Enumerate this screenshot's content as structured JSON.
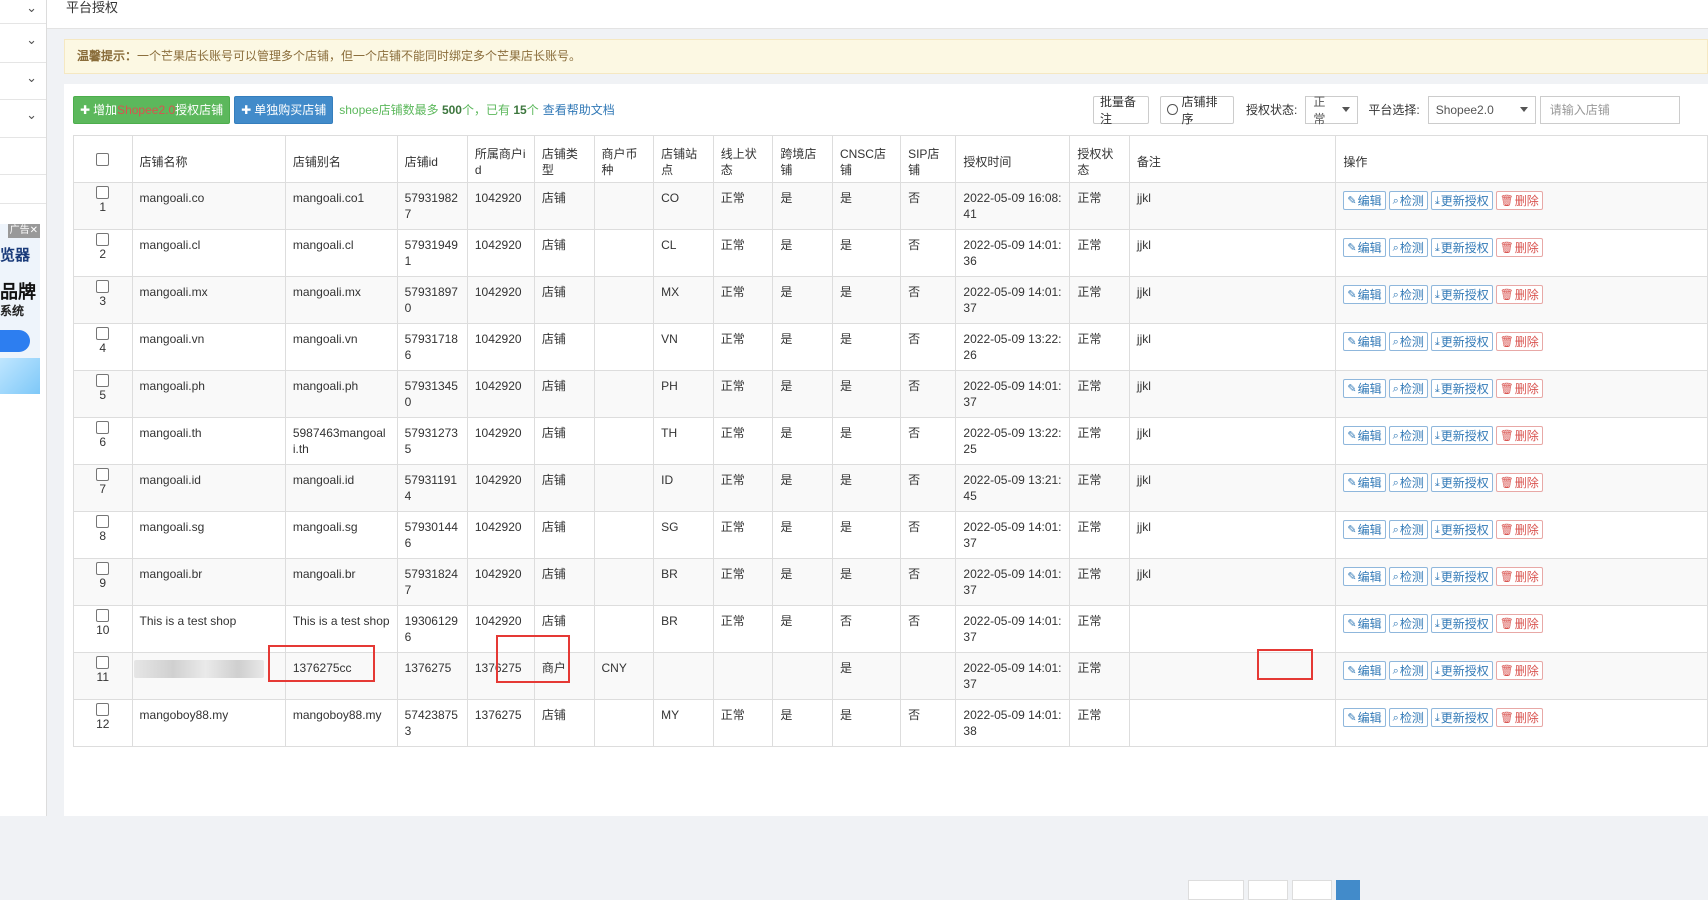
{
  "page": {
    "breadcrumb": "平台授权"
  },
  "tip": {
    "label": "温馨提示：",
    "text": "一个芒果店长账号可以管理多个店铺，但一个店铺不能同时绑定多个芒果店长账号。"
  },
  "toolbar": {
    "add_prefix": "增加",
    "add_highlight": "Shopee2.0",
    "add_suffix": "授权店铺",
    "buy_label": "单独购买店铺",
    "info_prefix": "shopee店铺数最多 ",
    "max_shops": "500",
    "info_middle": "个，已有 ",
    "current_shops": "15",
    "info_suffix": "个",
    "help_link": "查看帮助文档",
    "batch_note": "批量备注",
    "sort_label": "店铺排序",
    "auth_status_label": "授权状态:",
    "auth_status_value": "正常",
    "platform_label": "平台选择:",
    "platform_value": "Shopee2.0",
    "search_placeholder": "请输入店铺"
  },
  "sidebar": {
    "ad_tag": "广告",
    "ad_close": "✕",
    "ad_line1": "览器",
    "ad_line2": "品牌",
    "ad_line3": "系统"
  },
  "table": {
    "headers": {
      "name": "店铺名称",
      "alias": "店铺别名",
      "id": "店铺id",
      "merchant_id": "所属商户id",
      "type": "店铺类型",
      "currency": "商户币种",
      "site": "店铺站点",
      "online": "线上状态",
      "cross": "跨境店铺",
      "cnsc": "CNSC店铺",
      "sip": "SIP店铺",
      "auth_time": "授权时间",
      "auth_status": "授权状态",
      "note": "备注",
      "ops": "操作"
    },
    "ops": {
      "edit": "编辑",
      "check": "检测",
      "renew": "更新授权",
      "delete": "删除"
    },
    "rows": [
      {
        "idx": "1",
        "name": "mangoali.co",
        "alias": "mangoali.co1",
        "id": "579319827",
        "merchant_id": "1042920",
        "type": "店铺",
        "currency": "",
        "site": "CO",
        "online": "正常",
        "cross": "是",
        "cnsc": "是",
        "sip": "否",
        "auth_time": "2022-05-09 16:08:41",
        "auth_status": "正常",
        "note": "jjkl"
      },
      {
        "idx": "2",
        "name": "mangoali.cl",
        "alias": "mangoali.cl",
        "id": "579319491",
        "merchant_id": "1042920",
        "type": "店铺",
        "currency": "",
        "site": "CL",
        "online": "正常",
        "cross": "是",
        "cnsc": "是",
        "sip": "否",
        "auth_time": "2022-05-09 14:01:36",
        "auth_status": "正常",
        "note": "jjkl"
      },
      {
        "idx": "3",
        "name": "mangoali.mx",
        "alias": "mangoali.mx",
        "id": "579318970",
        "merchant_id": "1042920",
        "type": "店铺",
        "currency": "",
        "site": "MX",
        "online": "正常",
        "cross": "是",
        "cnsc": "是",
        "sip": "否",
        "auth_time": "2022-05-09 14:01:37",
        "auth_status": "正常",
        "note": "jjkl"
      },
      {
        "idx": "4",
        "name": "mangoali.vn",
        "alias": "mangoali.vn",
        "id": "579317186",
        "merchant_id": "1042920",
        "type": "店铺",
        "currency": "",
        "site": "VN",
        "online": "正常",
        "cross": "是",
        "cnsc": "是",
        "sip": "否",
        "auth_time": "2022-05-09 13:22:26",
        "auth_status": "正常",
        "note": "jjkl"
      },
      {
        "idx": "5",
        "name": "mangoali.ph",
        "alias": "mangoali.ph",
        "id": "579313450",
        "merchant_id": "1042920",
        "type": "店铺",
        "currency": "",
        "site": "PH",
        "online": "正常",
        "cross": "是",
        "cnsc": "是",
        "sip": "否",
        "auth_time": "2022-05-09 14:01:37",
        "auth_status": "正常",
        "note": "jjkl"
      },
      {
        "idx": "6",
        "name": "mangoali.th",
        "alias": "5987463mangoali.th",
        "id": "579312735",
        "merchant_id": "1042920",
        "type": "店铺",
        "currency": "",
        "site": "TH",
        "online": "正常",
        "cross": "是",
        "cnsc": "是",
        "sip": "否",
        "auth_time": "2022-05-09 13:22:25",
        "auth_status": "正常",
        "note": "jjkl"
      },
      {
        "idx": "7",
        "name": "mangoali.id",
        "alias": "mangoali.id",
        "id": "579311914",
        "merchant_id": "1042920",
        "type": "店铺",
        "currency": "",
        "site": "ID",
        "online": "正常",
        "cross": "是",
        "cnsc": "是",
        "sip": "否",
        "auth_time": "2022-05-09 13:21:45",
        "auth_status": "正常",
        "note": "jjkl"
      },
      {
        "idx": "8",
        "name": "mangoali.sg",
        "alias": "mangoali.sg",
        "id": "579301446",
        "merchant_id": "1042920",
        "type": "店铺",
        "currency": "",
        "site": "SG",
        "online": "正常",
        "cross": "是",
        "cnsc": "是",
        "sip": "否",
        "auth_time": "2022-05-09 14:01:37",
        "auth_status": "正常",
        "note": "jjkl"
      },
      {
        "idx": "9",
        "name": "mangoali.br",
        "alias": "mangoali.br",
        "id": "579318247",
        "merchant_id": "1042920",
        "type": "店铺",
        "currency": "",
        "site": "BR",
        "online": "正常",
        "cross": "是",
        "cnsc": "是",
        "sip": "否",
        "auth_time": "2022-05-09 14:01:37",
        "auth_status": "正常",
        "note": "jjkl"
      },
      {
        "idx": "10",
        "name": "This is a test shop",
        "alias": "This is a test shop",
        "id": "193061296",
        "merchant_id": "1042920",
        "type": "店铺",
        "currency": "",
        "site": "BR",
        "online": "正常",
        "cross": "是",
        "cnsc": "否",
        "sip": "否",
        "auth_time": "2022-05-09 14:01:37",
        "auth_status": "正常",
        "note": ""
      },
      {
        "idx": "11",
        "name": "",
        "alias": "1376275cc",
        "id": "1376275",
        "merchant_id": "1376275",
        "type": "商户",
        "currency": "CNY",
        "site": "",
        "online": "",
        "cross": "",
        "cnsc": "是",
        "sip": "",
        "auth_time": "2022-05-09 14:01:37",
        "auth_status": "正常",
        "note": ""
      },
      {
        "idx": "12",
        "name": "mangoboy88.my",
        "alias": "mangoboy88.my",
        "id": "574238753",
        "merchant_id": "1376275",
        "type": "店铺",
        "currency": "",
        "site": "MY",
        "online": "正常",
        "cross": "是",
        "cnsc": "是",
        "sip": "否",
        "auth_time": "2022-05-09 14:01:38",
        "auth_status": "正常",
        "note": ""
      }
    ]
  }
}
